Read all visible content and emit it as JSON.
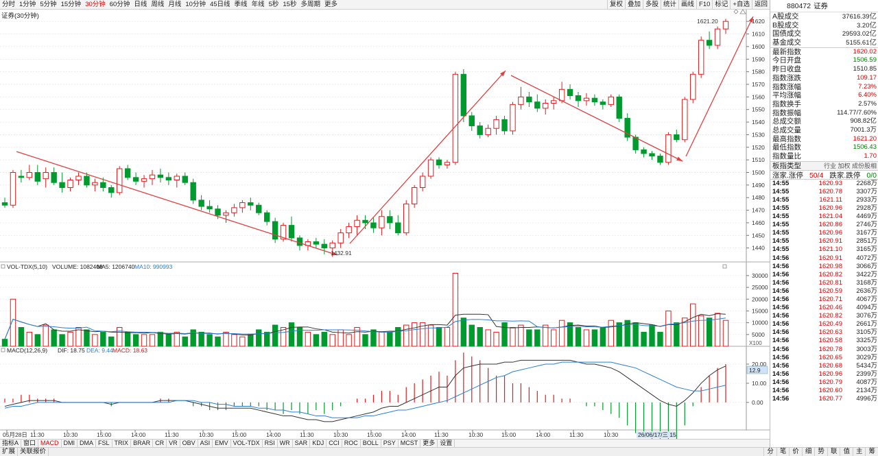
{
  "toolbar": {
    "periods": [
      "分时",
      "1分钟",
      "5分钟",
      "15分钟",
      "30分钟",
      "60分钟",
      "日线",
      "周线",
      "月线",
      "10分钟",
      "45日线",
      "季线",
      "年线",
      "5秒",
      "15秒",
      "多周期",
      "更多"
    ],
    "active_period": "30分钟",
    "tools": [
      "复权",
      "叠加",
      "多股",
      "统计",
      "画线",
      "F10",
      "标记",
      "+自选",
      "返回"
    ]
  },
  "chart": {
    "title": "证券(30分钟)",
    "high_label": "1621.20",
    "low_label": "1432.91",
    "vol_legend": {
      "name": "VOL-TDX(5,10)",
      "volume": "VOLUME: 1082408",
      "ma5": "MA5: 1206740",
      "ma10": "MA10: 990993"
    },
    "macd_legend": {
      "name": "MACD(12,26,9)",
      "dif": "DIF: 18.75",
      "dea": "DEA: 9.44",
      "macd": "MACD: 18.63"
    },
    "price_ticks": [
      "1620",
      "1610",
      "1600",
      "1590",
      "1580",
      "1570",
      "1560",
      "1550",
      "1540",
      "1530",
      "1520",
      "1510",
      "1500",
      "1490",
      "1480",
      "1470",
      "1460",
      "1450",
      "1440"
    ],
    "vol_ticks": [
      "30000",
      "25000",
      "20000",
      "15000",
      "10000",
      "5000"
    ],
    "vol_unit": "X100",
    "macd_ticks": [
      "20.00",
      "10.00",
      "0.00"
    ],
    "macd_marker": "12.9",
    "time_labels": [
      "05月28日",
      "11:30",
      "10:30",
      "15:00",
      "14:00",
      "11:30",
      "10:30",
      "15:00",
      "14:00",
      "11:30",
      "10:30",
      "15:00",
      "14:00",
      "11:30",
      "10:30",
      "15:00",
      "14:00",
      "11:30",
      "10:30"
    ],
    "time_tail": "26/06/17/三 15"
  },
  "chart_data": {
    "type": "candlestick",
    "title": "证券(30分钟)",
    "price_ylim": [
      1430,
      1625
    ],
    "ohlc": [
      [
        1476,
        1480,
        1472,
        1474
      ],
      [
        1474,
        1502,
        1472,
        1500
      ],
      [
        1497,
        1502,
        1492,
        1496
      ],
      [
        1496,
        1506,
        1494,
        1500
      ],
      [
        1500,
        1506,
        1490,
        1493
      ],
      [
        1495,
        1504,
        1488,
        1500
      ],
      [
        1500,
        1504,
        1490,
        1492
      ],
      [
        1492,
        1500,
        1484,
        1488
      ],
      [
        1488,
        1496,
        1485,
        1494
      ],
      [
        1494,
        1500,
        1490,
        1497
      ],
      [
        1497,
        1500,
        1488,
        1490
      ],
      [
        1490,
        1495,
        1485,
        1492
      ],
      [
        1492,
        1496,
        1485,
        1488
      ],
      [
        1488,
        1490,
        1480,
        1484
      ],
      [
        1484,
        1505,
        1482,
        1503
      ],
      [
        1503,
        1506,
        1494,
        1496
      ],
      [
        1496,
        1500,
        1490,
        1493
      ],
      [
        1493,
        1498,
        1488,
        1495
      ],
      [
        1495,
        1502,
        1490,
        1498
      ],
      [
        1498,
        1503,
        1492,
        1496
      ],
      [
        1496,
        1500,
        1490,
        1494
      ],
      [
        1494,
        1499,
        1488,
        1497
      ],
      [
        1497,
        1500,
        1490,
        1492
      ],
      [
        1492,
        1495,
        1475,
        1478
      ],
      [
        1478,
        1482,
        1470,
        1473
      ],
      [
        1473,
        1478,
        1468,
        1471
      ],
      [
        1471,
        1474,
        1463,
        1466
      ],
      [
        1466,
        1470,
        1460,
        1468
      ],
      [
        1468,
        1475,
        1465,
        1472
      ],
      [
        1472,
        1478,
        1468,
        1476
      ],
      [
        1476,
        1480,
        1470,
        1474
      ],
      [
        1474,
        1476,
        1466,
        1468
      ],
      [
        1468,
        1470,
        1458,
        1461
      ],
      [
        1461,
        1464,
        1444,
        1447
      ],
      [
        1447,
        1460,
        1445,
        1458
      ],
      [
        1458,
        1465,
        1445,
        1448
      ],
      [
        1448,
        1450,
        1438,
        1442
      ],
      [
        1442,
        1447,
        1438,
        1445
      ],
      [
        1445,
        1448,
        1440,
        1443
      ],
      [
        1443,
        1447,
        1435,
        1440
      ],
      [
        1440,
        1446,
        1433,
        1444
      ],
      [
        1444,
        1455,
        1440,
        1452
      ],
      [
        1452,
        1460,
        1448,
        1457
      ],
      [
        1457,
        1466,
        1450,
        1462
      ],
      [
        1462,
        1466,
        1455,
        1460
      ],
      [
        1460,
        1464,
        1452,
        1456
      ],
      [
        1456,
        1470,
        1450,
        1465
      ],
      [
        1465,
        1470,
        1455,
        1460
      ],
      [
        1460,
        1466,
        1450,
        1452
      ],
      [
        1452,
        1478,
        1450,
        1475
      ],
      [
        1475,
        1490,
        1472,
        1488
      ],
      [
        1488,
        1500,
        1485,
        1497
      ],
      [
        1497,
        1512,
        1495,
        1510
      ],
      [
        1510,
        1512,
        1503,
        1506
      ],
      [
        1506,
        1510,
        1503,
        1508
      ],
      [
        1508,
        1580,
        1506,
        1578
      ],
      [
        1578,
        1582,
        1540,
        1545
      ],
      [
        1545,
        1548,
        1533,
        1537
      ],
      [
        1537,
        1540,
        1527,
        1530
      ],
      [
        1530,
        1538,
        1528,
        1535
      ],
      [
        1535,
        1545,
        1530,
        1542
      ],
      [
        1542,
        1545,
        1530,
        1533
      ],
      [
        1533,
        1556,
        1530,
        1554
      ],
      [
        1554,
        1568,
        1550,
        1560
      ],
      [
        1560,
        1564,
        1552,
        1556
      ],
      [
        1556,
        1562,
        1548,
        1551
      ],
      [
        1551,
        1558,
        1546,
        1555
      ],
      [
        1555,
        1560,
        1550,
        1557
      ],
      [
        1557,
        1572,
        1555,
        1566
      ],
      [
        1566,
        1570,
        1558,
        1561
      ],
      [
        1561,
        1564,
        1552,
        1557
      ],
      [
        1557,
        1563,
        1553,
        1559
      ],
      [
        1559,
        1562,
        1553,
        1556
      ],
      [
        1556,
        1558,
        1550,
        1554
      ],
      [
        1554,
        1562,
        1552,
        1560
      ],
      [
        1560,
        1562,
        1540,
        1543
      ],
      [
        1543,
        1547,
        1525,
        1528
      ],
      [
        1528,
        1530,
        1515,
        1518
      ],
      [
        1518,
        1520,
        1512,
        1515
      ],
      [
        1515,
        1517,
        1510,
        1513
      ],
      [
        1513,
        1515,
        1506,
        1508
      ],
      [
        1508,
        1532,
        1506,
        1530
      ],
      [
        1530,
        1534,
        1524,
        1526
      ],
      [
        1526,
        1560,
        1524,
        1558
      ],
      [
        1558,
        1580,
        1555,
        1578
      ],
      [
        1578,
        1608,
        1575,
        1605
      ],
      [
        1605,
        1612,
        1598,
        1601
      ],
      [
        1601,
        1616,
        1598,
        1614
      ],
      [
        1614,
        1622,
        1610,
        1620
      ]
    ],
    "volume": [
      3000,
      20000,
      8000,
      6000,
      5000,
      9000,
      7000,
      5000,
      6000,
      8000,
      7000,
      5000,
      6000,
      4000,
      8000,
      6000,
      5000,
      5000,
      5000,
      6000,
      5000,
      6000,
      4000,
      7000,
      6000,
      5000,
      4000,
      6000,
      5000,
      4000,
      5000,
      7000,
      6000,
      9000,
      8000,
      10000,
      8000,
      6000,
      5000,
      6000,
      5000,
      7000,
      5000,
      8000,
      5000,
      7000,
      6000,
      6000,
      8000,
      9000,
      10000,
      10000,
      9000,
      8000,
      8000,
      31000,
      12000,
      9000,
      8000,
      7000,
      6000,
      10000,
      8000,
      9000,
      7000,
      7000,
      9000,
      7000,
      11000,
      10000,
      8000,
      7000,
      7000,
      8000,
      11000,
      10000,
      11000,
      10000,
      6000,
      9000,
      6000,
      15000,
      10000,
      12000,
      18000,
      13000,
      12000,
      14000,
      11000
    ],
    "vol_ylim": [
      0,
      32000
    ],
    "dif": [
      -2,
      -1,
      0,
      1,
      1,
      1,
      1,
      0,
      0,
      0,
      0,
      0,
      0,
      -1,
      0,
      0,
      0,
      0,
      0,
      1,
      1,
      1,
      1,
      0,
      -1,
      -2,
      -3,
      -3,
      -3,
      -3,
      -3,
      -4,
      -5,
      -6,
      -7,
      -7,
      -8,
      -9,
      -9,
      -10,
      -10,
      -9,
      -8,
      -7,
      -6,
      -5,
      -3,
      -2,
      -2,
      0,
      2,
      4,
      6,
      8,
      8,
      14,
      18,
      19,
      20,
      20,
      20,
      21,
      21,
      22,
      22,
      22,
      22,
      22,
      22,
      22,
      21,
      20,
      20,
      19,
      18,
      16,
      13,
      10,
      7,
      4,
      1,
      -1,
      -2,
      1,
      5,
      10,
      14,
      17,
      19
    ],
    "dea": [
      -3,
      -2,
      -2,
      -1,
      0,
      0,
      0,
      0,
      0,
      0,
      0,
      0,
      0,
      0,
      0,
      0,
      0,
      0,
      0,
      0,
      0,
      1,
      1,
      1,
      0,
      0,
      -1,
      -1,
      -2,
      -2,
      -2,
      -3,
      -3,
      -4,
      -4,
      -5,
      -5,
      -6,
      -7,
      -7,
      -8,
      -8,
      -8,
      -8,
      -7,
      -7,
      -6,
      -5,
      -4,
      -4,
      -3,
      -2,
      -1,
      0,
      1,
      3,
      5,
      7,
      9,
      11,
      13,
      14,
      16,
      17,
      18,
      19,
      20,
      20,
      21,
      21,
      21,
      21,
      21,
      21,
      21,
      20,
      19,
      18,
      16,
      14,
      12,
      10,
      8,
      7,
      6,
      6,
      7,
      8,
      9
    ],
    "macd_ylim": [
      -14,
      25
    ]
  },
  "panel": {
    "code": "880472",
    "name": "证券",
    "top_rows": [
      {
        "label": "A股成交",
        "value": "37616.39",
        "unit": "亿"
      },
      {
        "label": "B股成交",
        "value": "3.20",
        "unit": "亿"
      },
      {
        "label": "国债成交",
        "value": "29593.02",
        "unit": "亿"
      },
      {
        "label": "基金成交",
        "value": "5155.61",
        "unit": "亿"
      }
    ],
    "stat_rows": [
      {
        "label": "最新指数",
        "value": "1620.02",
        "color": "red"
      },
      {
        "label": "今日开盘",
        "value": "1506.59",
        "color": "green"
      },
      {
        "label": "昨日收盘",
        "value": "1510.85",
        "color": "blk"
      },
      {
        "label": "指数涨跌",
        "value": "109.17",
        "color": "red"
      },
      {
        "label": "指数涨幅",
        "value": "7.23%",
        "color": "red"
      },
      {
        "label": "平均涨幅",
        "value": "6.40%",
        "color": "red"
      },
      {
        "label": "指数换手",
        "value": "2.57%",
        "color": "blk"
      },
      {
        "label": "指数振幅",
        "value": "114.77/7.60%",
        "color": "blk"
      },
      {
        "label": "总成交额",
        "value": "908.82亿",
        "color": "blk"
      },
      {
        "label": "总成交量",
        "value": "7001.3万",
        "color": "blk"
      },
      {
        "label": "最高指数",
        "value": "1621.20",
        "color": "red"
      },
      {
        "label": "最低指数",
        "value": "1506.43",
        "color": "green"
      },
      {
        "label": "指数量比",
        "value": "1.70",
        "color": "red"
      }
    ],
    "board_label": "板指类型",
    "board_opts": "行业 加权 成份股相",
    "limit_left": "涨家.涨停",
    "limit_mid": "50/4",
    "limit_mid2": "跌家.跌停",
    "limit_right": "0/0",
    "ticks": [
      {
        "time": "14:55",
        "price": "1620.93",
        "vol": "2268万"
      },
      {
        "time": "14:55",
        "price": "1620.78",
        "vol": "3307万"
      },
      {
        "time": "14:55",
        "price": "1621.11",
        "vol": "2933万"
      },
      {
        "time": "14:55",
        "price": "1620.96",
        "vol": "2928万"
      },
      {
        "time": "14:55",
        "price": "1621.04",
        "vol": "4469万"
      },
      {
        "time": "14:55",
        "price": "1620.86",
        "vol": "2746万"
      },
      {
        "time": "14:55",
        "price": "1620.96",
        "vol": "3167万"
      },
      {
        "time": "14:55",
        "price": "1620.91",
        "vol": "2851万"
      },
      {
        "time": "14:55",
        "price": "1621.10",
        "vol": "3165万"
      },
      {
        "time": "14:56",
        "price": "1620.91",
        "vol": "4072万"
      },
      {
        "time": "14:56",
        "price": "1620.98",
        "vol": "3066万"
      },
      {
        "time": "14:56",
        "price": "1620.82",
        "vol": "3422万"
      },
      {
        "time": "14:56",
        "price": "1620.81",
        "vol": "3168万"
      },
      {
        "time": "14:56",
        "price": "1620.59",
        "vol": "2636万"
      },
      {
        "time": "14:56",
        "price": "1620.71",
        "vol": "4067万"
      },
      {
        "time": "14:56",
        "price": "1620.46",
        "vol": "4094万"
      },
      {
        "time": "14:56",
        "price": "1620.82",
        "vol": "3076万"
      },
      {
        "time": "14:56",
        "price": "1620.49",
        "vol": "2661万"
      },
      {
        "time": "14:56",
        "price": "1620.63",
        "vol": "3105万"
      },
      {
        "time": "14:56",
        "price": "1620.58",
        "vol": "3325万"
      },
      {
        "time": "14:56",
        "price": "1620.78",
        "vol": "3003万"
      },
      {
        "time": "14:56",
        "price": "1620.65",
        "vol": "3029万"
      },
      {
        "time": "14:56",
        "price": "1620.68",
        "vol": "5434万"
      },
      {
        "time": "14:56",
        "price": "1620.96",
        "vol": "2399万"
      },
      {
        "time": "14:56",
        "price": "1620.79",
        "vol": "4087万"
      },
      {
        "time": "14:56",
        "price": "1620.60",
        "vol": "2134万"
      },
      {
        "time": "14:56",
        "price": "1620.77",
        "vol": "4996万"
      }
    ]
  },
  "indicator_tabs": [
    "指标A",
    "窗口",
    "MACD",
    "DMI",
    "DMA",
    "FSL",
    "TRIX",
    "BRAR",
    "CR",
    "VR",
    "OBV",
    "ASI",
    "EMV",
    "VOL-TDX",
    "RSI",
    "WR",
    "SAR",
    "KDJ",
    "CCI",
    "ROC",
    "BOLL",
    "PSY",
    "MCST",
    "更多",
    "设置"
  ],
  "active_indicator": "MACD",
  "ext_bar": [
    "扩展",
    "关联报价"
  ],
  "side_bottom": [
    "分",
    "笔",
    "价",
    "细",
    "势",
    "联",
    "值",
    "主",
    "筹"
  ]
}
